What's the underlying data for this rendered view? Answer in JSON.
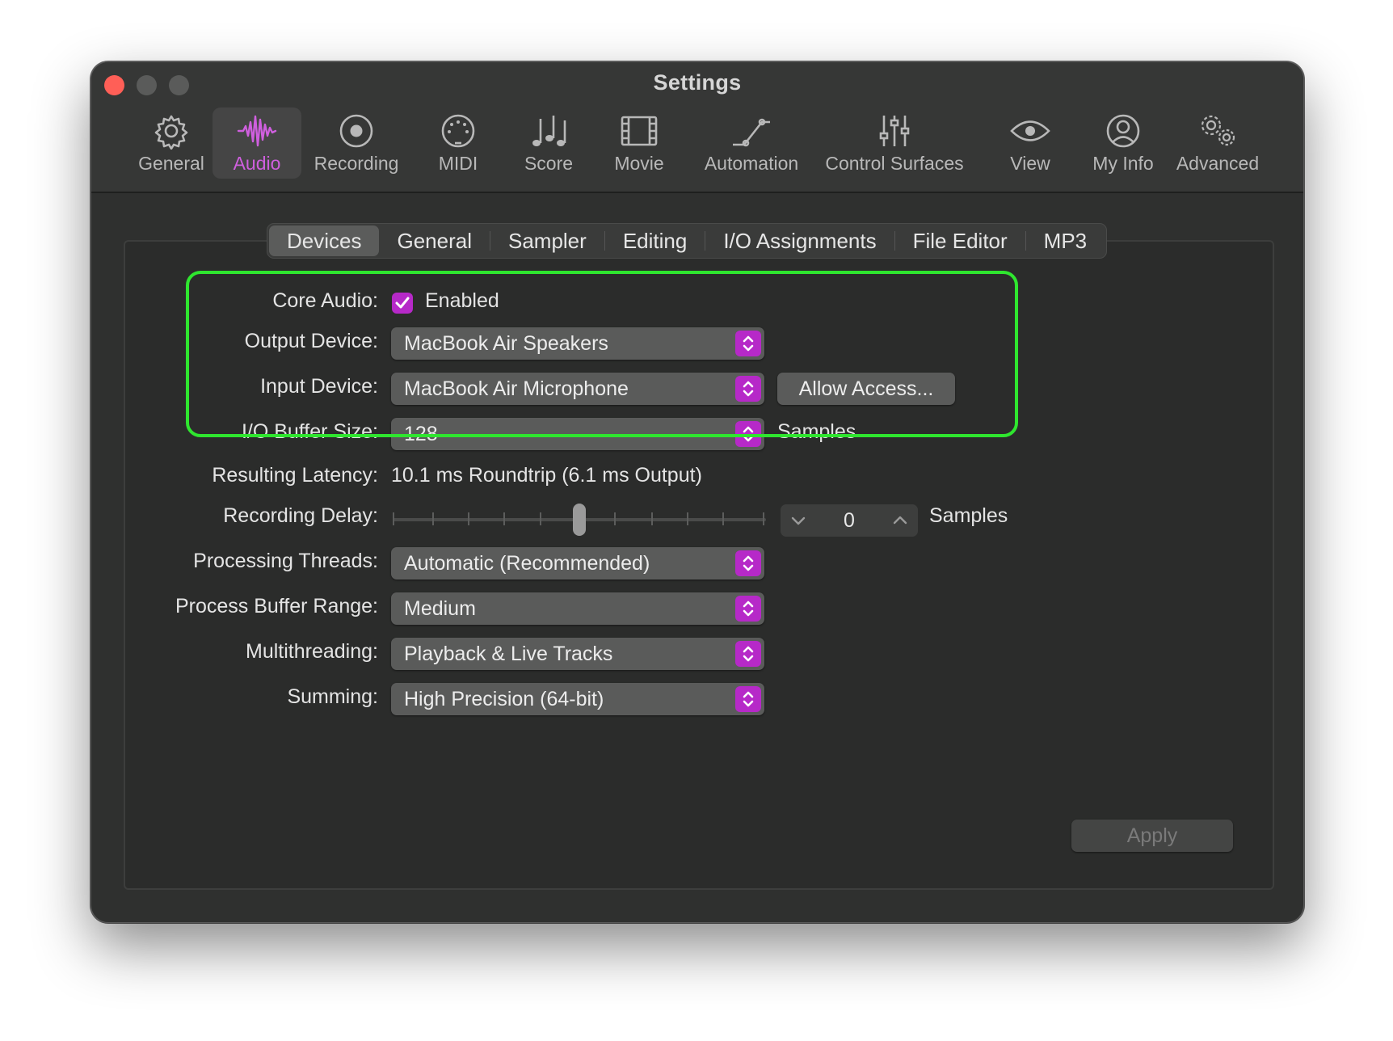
{
  "window": {
    "title": "Settings"
  },
  "toolbar": {
    "items": [
      {
        "label": "General",
        "icon": "gear-icon"
      },
      {
        "label": "Audio",
        "icon": "waveform-icon",
        "active": true
      },
      {
        "label": "Recording",
        "icon": "record-icon"
      },
      {
        "label": "MIDI",
        "icon": "midi-connector-icon"
      },
      {
        "label": "Score",
        "icon": "music-notes-icon"
      },
      {
        "label": "Movie",
        "icon": "film-icon"
      },
      {
        "label": "Automation",
        "icon": "automation-curve-icon"
      },
      {
        "label": "Control Surfaces",
        "icon": "faders-icon"
      },
      {
        "label": "View",
        "icon": "eye-icon"
      },
      {
        "label": "My Info",
        "icon": "person-icon"
      },
      {
        "label": "Advanced",
        "icon": "gears-icon"
      }
    ]
  },
  "tabs": [
    {
      "label": "Devices",
      "selected": true
    },
    {
      "label": "General"
    },
    {
      "label": "Sampler"
    },
    {
      "label": "Editing"
    },
    {
      "label": "I/O Assignments"
    },
    {
      "label": "File Editor"
    },
    {
      "label": "MP3"
    }
  ],
  "form": {
    "core_audio": {
      "label": "Core Audio:",
      "checkbox_label": "Enabled",
      "checked": true
    },
    "output_device": {
      "label": "Output Device:",
      "value": "MacBook Air Speakers"
    },
    "input_device": {
      "label": "Input Device:",
      "value": "MacBook Air Microphone",
      "button": "Allow Access..."
    },
    "io_buffer": {
      "label": "I/O Buffer Size:",
      "value": "128",
      "unit": "Samples"
    },
    "latency": {
      "label": "Resulting Latency:",
      "value": "10.1 ms Roundtrip (6.1 ms Output)"
    },
    "recording_delay": {
      "label": "Recording Delay:",
      "value": "0",
      "unit": "Samples"
    },
    "processing_threads": {
      "label": "Processing Threads:",
      "value": "Automatic (Recommended)"
    },
    "process_buffer": {
      "label": "Process Buffer Range:",
      "value": "Medium"
    },
    "multithreading": {
      "label": "Multithreading:",
      "value": "Playback & Live Tracks"
    },
    "summing": {
      "label": "Summing:",
      "value": "High Precision (64-bit)"
    }
  },
  "apply_button": "Apply",
  "colors": {
    "accent": "#b629c8",
    "active_toolbar_text": "#cf5fde",
    "highlight": "#2fe62f",
    "window_bg": "#2f302f"
  }
}
